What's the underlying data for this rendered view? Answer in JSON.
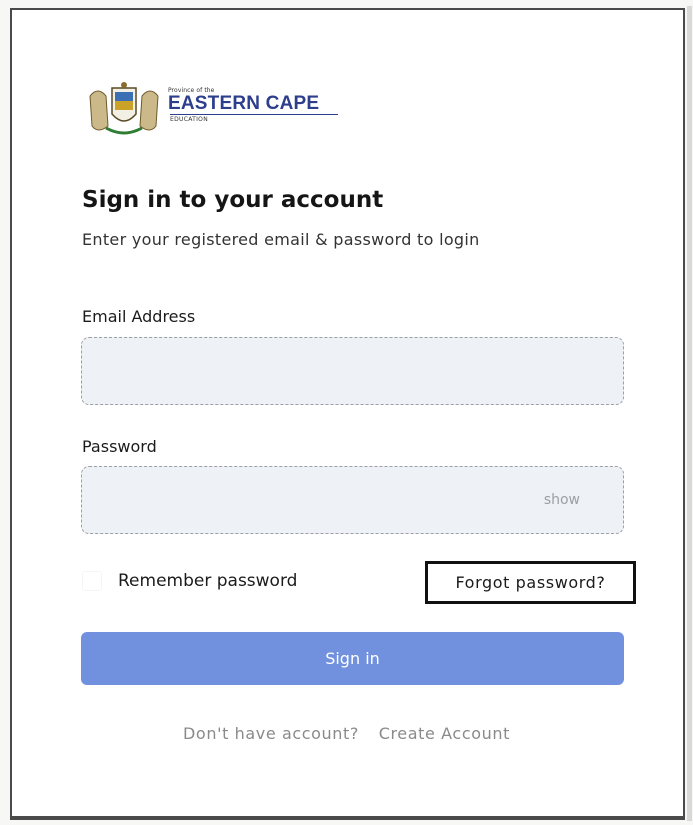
{
  "logo": {
    "small_text": "Province of the",
    "main_text": "EASTERN CAPE",
    "sub_text": "EDUCATION"
  },
  "form": {
    "title": "Sign in to your account",
    "subtitle": "Enter your registered email & password to login",
    "email": {
      "label": "Email Address",
      "value": "",
      "placeholder": ""
    },
    "password": {
      "label": "Password",
      "value": "",
      "placeholder": "",
      "toggle_label": "show"
    },
    "remember": {
      "label": "Remember password",
      "checked": false
    },
    "forgot_label": "Forgot password?",
    "submit_label": "Sign in"
  },
  "footer": {
    "prompt": "Don't have account?",
    "link": "Create Account"
  },
  "colors": {
    "primary": "#7191df",
    "field_bg": "#eef1f5",
    "brand": "#2c3e8c"
  }
}
